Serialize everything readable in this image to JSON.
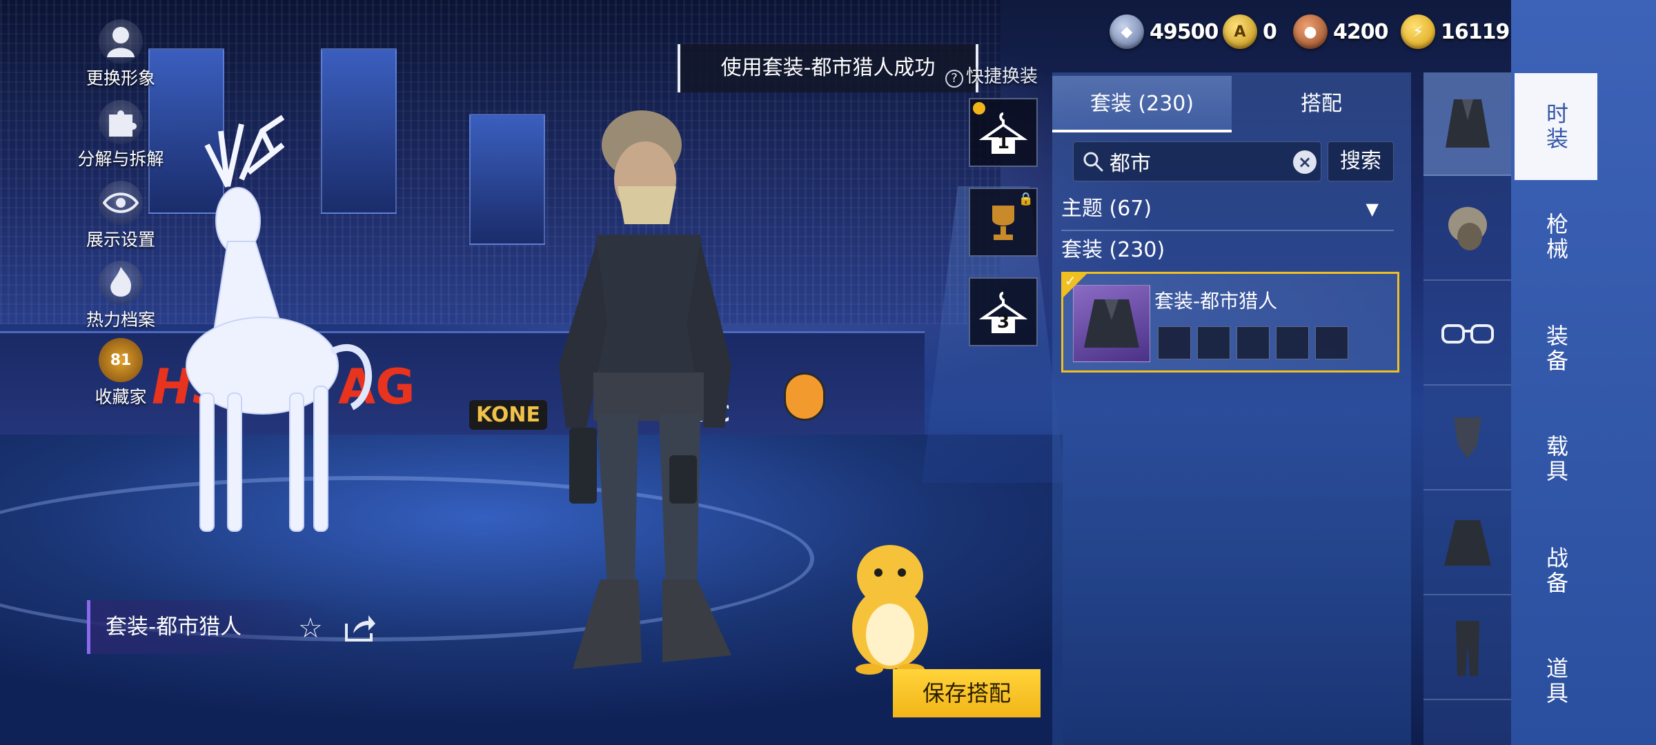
{
  "left_menu": {
    "change_avatar": "更换形象",
    "decompose": "分解与拆解",
    "display_settings": "展示设置",
    "hot_files": "热力档案",
    "collector": "收藏家",
    "collector_level": "81"
  },
  "toast": {
    "text": "使用套装-都市猎人成功"
  },
  "currencies": [
    {
      "icon": "silver-coin-icon",
      "value": "49500",
      "color": "#7a8db8"
    },
    {
      "icon": "ag-coin-icon",
      "value": "0",
      "color": "#d4a21b"
    },
    {
      "icon": "bronze-coin-icon",
      "value": "4200",
      "color": "#b46a3a"
    },
    {
      "icon": "energy-coin-icon",
      "value": "16119",
      "color": "#e8b21a"
    }
  ],
  "quick_change": {
    "title": "快捷换装",
    "slots": [
      "1",
      "",
      "3"
    ]
  },
  "panel": {
    "tabs": [
      "套装 (230)",
      "搭配"
    ],
    "search": {
      "value": "都市",
      "button": "搜索"
    },
    "filter_theme": "主题 (67)",
    "filter_set": "套装 (230)",
    "result": {
      "title": "套装-都市猎人"
    }
  },
  "categories": [
    "outfit-icon",
    "hair-icon",
    "glasses-icon",
    "mask-icon",
    "jacket-icon",
    "pants-icon"
  ],
  "right_nav": [
    "时装",
    "枪械",
    "装备",
    "载具",
    "战备",
    "道具"
  ],
  "outfit_name": "套装-都市猎人",
  "save_button": "保存搭配",
  "ad_logos": [
    "HS",
    "AG",
    "KONE",
    "EC"
  ],
  "colors": {
    "accent_yellow": "#f2b519",
    "highlight_purple": "#8a6bf0"
  }
}
